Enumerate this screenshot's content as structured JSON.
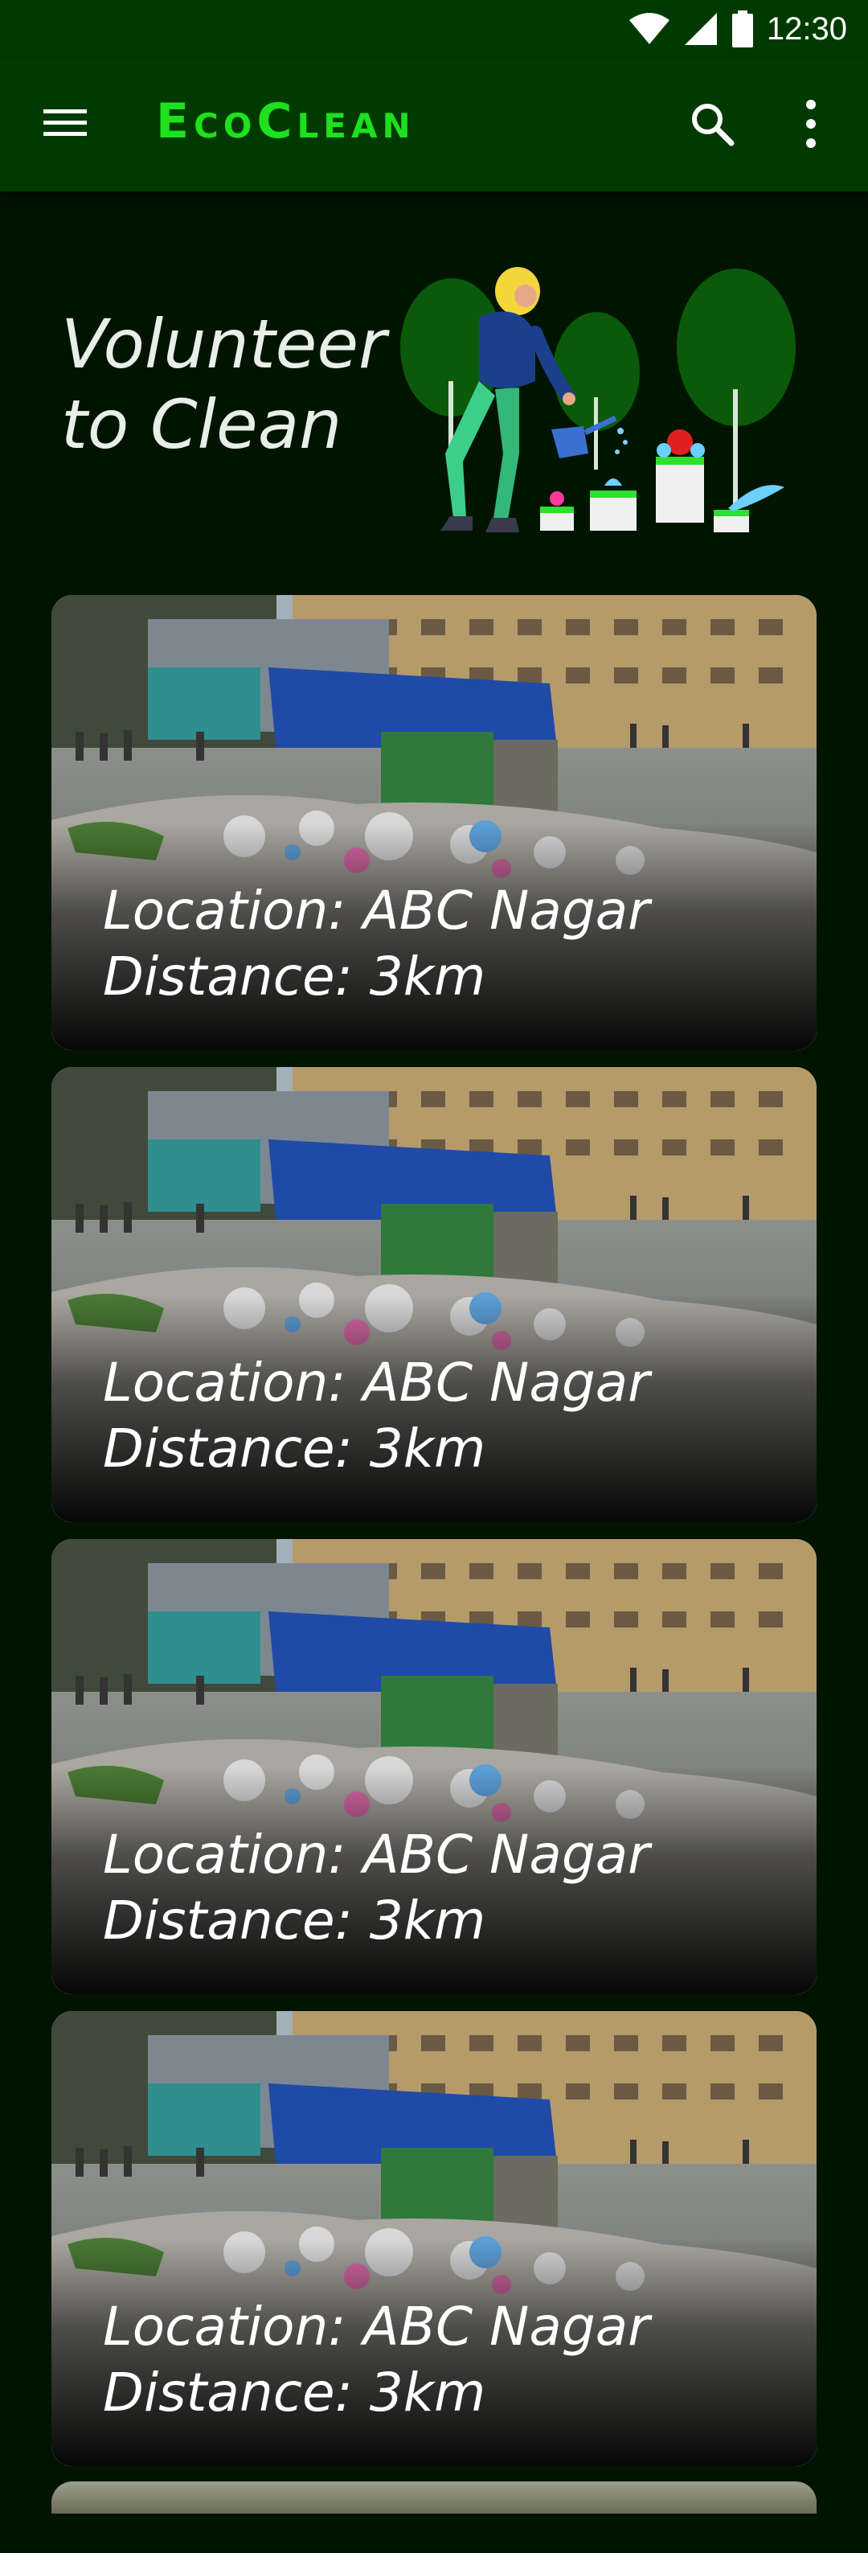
{
  "status_bar": {
    "time": "12:30",
    "icons": [
      "wifi-icon",
      "cellular-signal-icon",
      "battery-icon"
    ]
  },
  "app_bar": {
    "title": "EcoClean",
    "menu_icon": "hamburger-menu-icon",
    "search_icon": "search-icon",
    "more_icon": "more-vertical-icon"
  },
  "hero": {
    "title_line1": "Volunteer",
    "title_line2": "to Clean",
    "illustration": "woman-watering-plants-illustration"
  },
  "colors": {
    "background": "#001400",
    "app_bar": "#003a00",
    "brand_green": "#1ee01e"
  },
  "cards": [
    {
      "location": "Location: ABC Nagar",
      "distance": "Distance: 3km"
    },
    {
      "location": "Location: ABC Nagar",
      "distance": "Distance: 3km"
    },
    {
      "location": "Location: ABC Nagar",
      "distance": "Distance: 3km"
    },
    {
      "location": "Location: ABC Nagar",
      "distance": "Distance: 3km"
    }
  ]
}
